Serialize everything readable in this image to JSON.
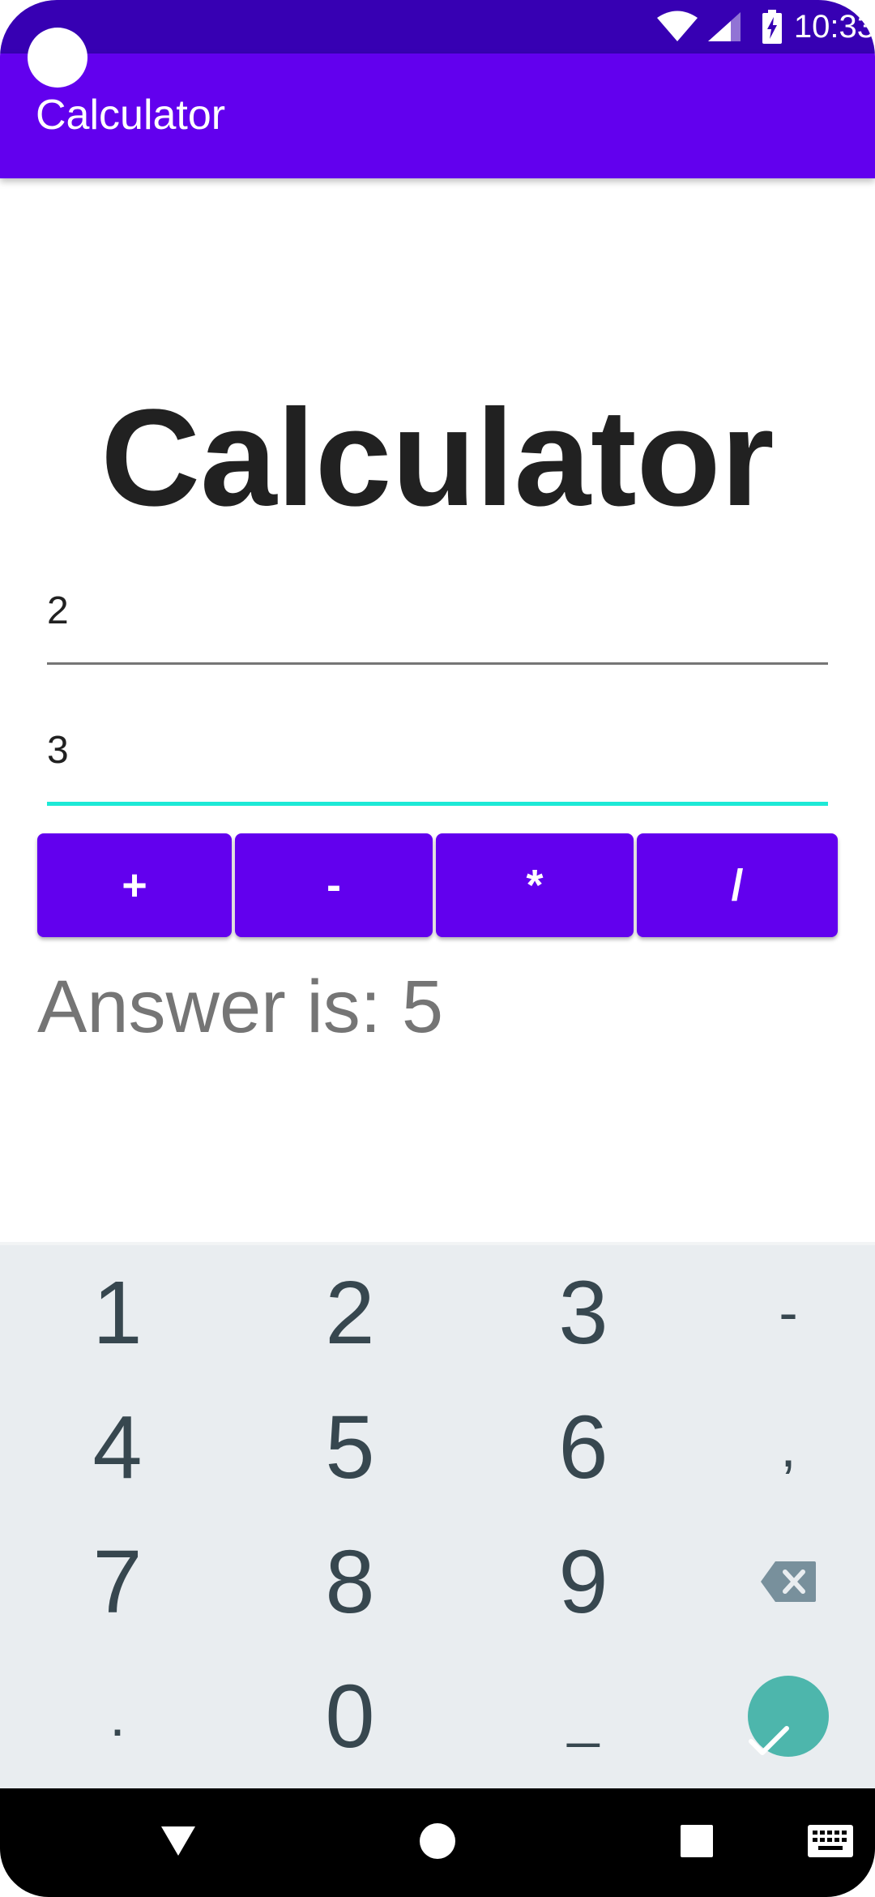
{
  "status_bar": {
    "time": "10:33",
    "icons": [
      "wifi-icon",
      "cell-signal-icon",
      "battery-charging-icon"
    ]
  },
  "app_bar": {
    "title": "Calculator"
  },
  "main": {
    "heading": "Calculator",
    "input1": {
      "value": "2"
    },
    "input2": {
      "value": "3"
    },
    "operations": [
      {
        "label": "+"
      },
      {
        "label": "-"
      },
      {
        "label": "*"
      },
      {
        "label": "/"
      }
    ],
    "answer": "Answer is: 5"
  },
  "keyboard": {
    "keys": [
      "1",
      "2",
      "3",
      "-",
      "4",
      "5",
      "6",
      ",",
      "7",
      "8",
      "9",
      ".",
      "0",
      "_"
    ],
    "backspace_icon": "backspace-icon",
    "done_icon": "check-icon"
  },
  "nav_bar": {
    "icons": [
      "back-icon",
      "home-icon",
      "recents-icon",
      "keyboard-icon"
    ]
  },
  "colors": {
    "status_bar": "#3700B3",
    "primary": "#6200EE",
    "accent_line": "#1DE9D6",
    "keyboard_bg": "#E9EDF0",
    "done_button": "#4DB6AC"
  }
}
